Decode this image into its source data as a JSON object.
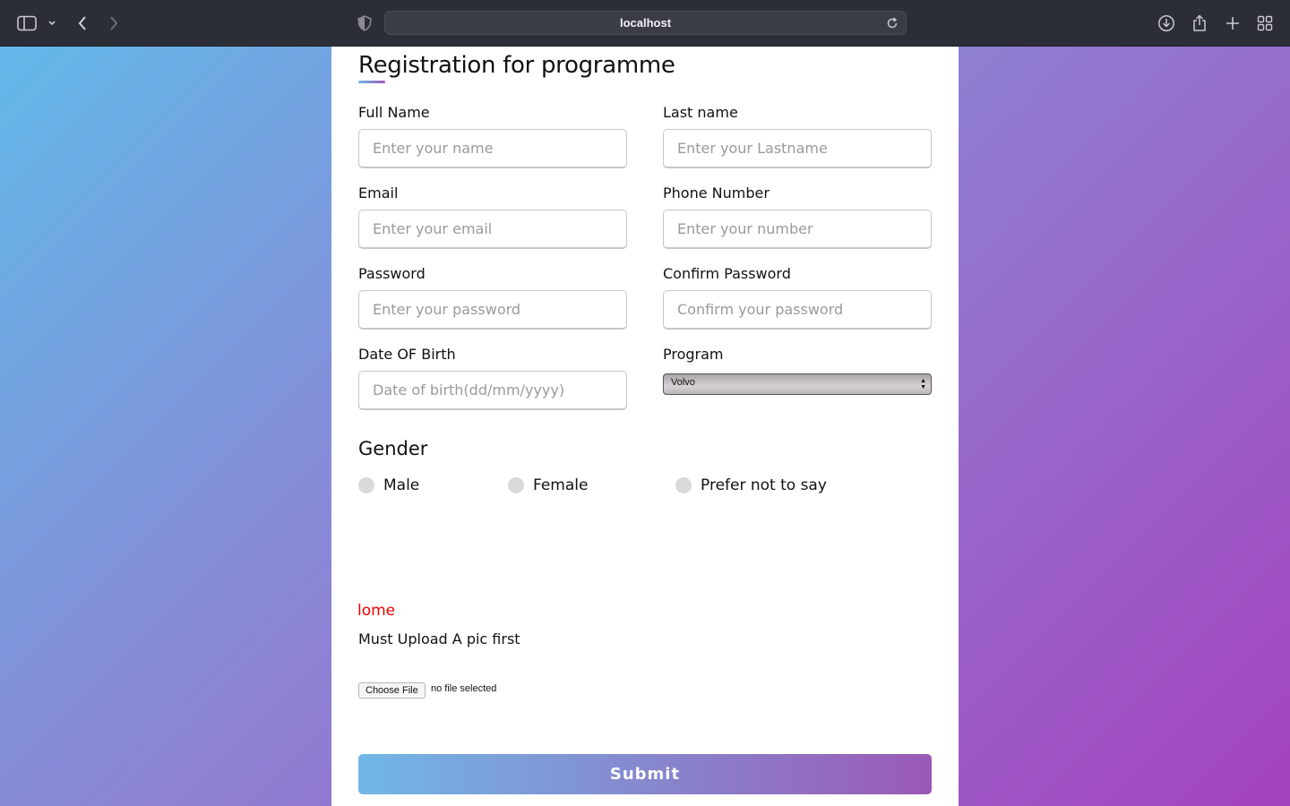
{
  "browser": {
    "url": "localhost"
  },
  "form": {
    "title": "Registration for programme",
    "fields": [
      {
        "label": "Full Name",
        "placeholder": "Enter your name"
      },
      {
        "label": "Last name",
        "placeholder": "Enter your Lastname"
      },
      {
        "label": "Email",
        "placeholder": "Enter your email"
      },
      {
        "label": "Phone Number",
        "placeholder": "Enter your number"
      },
      {
        "label": "Password",
        "placeholder": "Enter your password"
      },
      {
        "label": "Confirm Password",
        "placeholder": "Confirm your password"
      },
      {
        "label": "Date OF Birth",
        "placeholder": "Date of birth(dd/mm/yyyy)"
      }
    ],
    "program": {
      "label": "Program",
      "selected": "Volvo"
    },
    "gender": {
      "title": "Gender",
      "options": [
        "Male",
        "Female",
        "Prefer not to say"
      ]
    },
    "error_text": "lome",
    "upload": {
      "label": "Must Upload A pic first",
      "button": "Choose File",
      "status": "no file selected"
    },
    "submit_label": "Submit"
  },
  "colors": {
    "gradient_start": "#71b7e6",
    "gradient_end": "#9b59b6",
    "error": "#ee0000"
  }
}
